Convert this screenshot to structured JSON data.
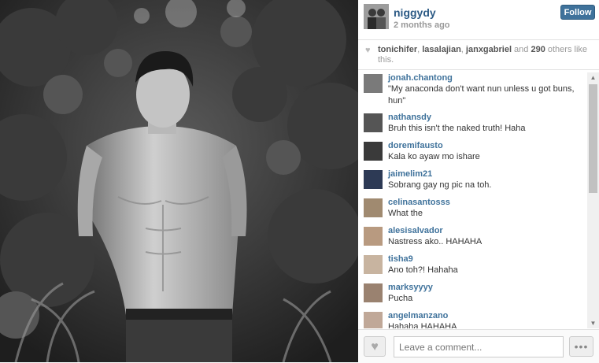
{
  "post": {
    "username": "niggydy",
    "time_ago": "2 months ago",
    "follow_label": "Follow"
  },
  "likes": {
    "user1": "tonichifer",
    "sep1": ", ",
    "user2": "lasalajian",
    "sep2": ", ",
    "user3": "janxgabriel",
    "and": " and ",
    "others_count": "290",
    "others_text": " others like this."
  },
  "comments": [
    {
      "user": "jonah.chantong",
      "text": "\"My anaconda don't want nun unless u got buns, hun\""
    },
    {
      "user": "nathansdy",
      "text": "Bruh this isn't the naked truth! Haha"
    },
    {
      "user": "doremifausto",
      "text": "Kala ko ayaw mo ishare"
    },
    {
      "user": "jaimelim21",
      "text": "Sobrang gay ng pic na toh."
    },
    {
      "user": "celinasantosss",
      "text": "What the"
    },
    {
      "user": "alesisalvador",
      "text": "Nastress ako.. HAHAHA"
    },
    {
      "user": "tisha9",
      "text": "Ano toh?! Hahaha"
    },
    {
      "user": "marksyyyy",
      "text": "Pucha"
    },
    {
      "user": "angelmanzano",
      "text": "Hahaha HAHAHA"
    }
  ],
  "footer": {
    "comment_placeholder": "Leave a comment...",
    "like_icon": "heart-icon",
    "more_icon": "ellipsis-icon"
  }
}
